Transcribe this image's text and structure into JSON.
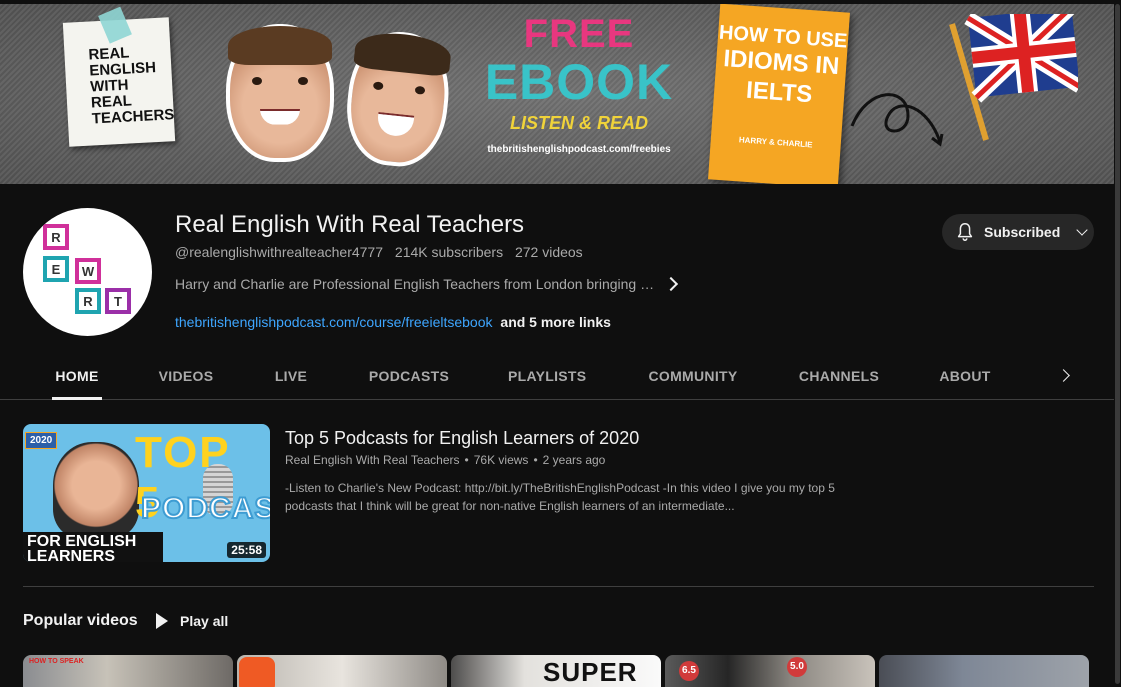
{
  "banner": {
    "note_text": "REAL ENGLISH WITH REAL TEACHERS",
    "promo_line1": "FREE",
    "promo_line2": "EBOOK",
    "promo_line3": "LISTEN & READ",
    "promo_url": "thebritishenglishpodcast.com/freebies",
    "book_line1": "HOW TO USE",
    "book_line2": "IDIOMS IN IELTS",
    "book_author": "HARRY & CHARLIE"
  },
  "channel": {
    "name": "Real English With Real Teachers",
    "handle": "@realenglishwithrealteacher4777",
    "subscribers": "214K subscribers",
    "videos": "272 videos",
    "description": "Harry and Charlie are Professional English Teachers from London bringing …",
    "link": "thebritishenglishpodcast.com/course/freeieltsebook",
    "more_links": "and 5 more links",
    "avatar_letters": [
      "R",
      "E",
      "W",
      "R",
      "T"
    ]
  },
  "subscribe_button": {
    "label": "Subscribed"
  },
  "tabs": [
    {
      "label": "HOME",
      "active": true
    },
    {
      "label": "VIDEOS"
    },
    {
      "label": "LIVE"
    },
    {
      "label": "PODCASTS"
    },
    {
      "label": "PLAYLISTS"
    },
    {
      "label": "COMMUNITY"
    },
    {
      "label": "CHANNELS"
    },
    {
      "label": "ABOUT"
    }
  ],
  "featured": {
    "title": "Top 5 Podcasts for English Learners of 2020",
    "channel": "Real English With Real Teachers",
    "views": "76K views",
    "age": "2 years ago",
    "description": "-Listen to Charlie's New Podcast: http://bit.ly/TheBritishEnglishPodcast -In this video I give you my top 5 podcasts that I think will be great for non-native English learners of an intermediate...",
    "duration": "25:58",
    "thumb_year": "2020",
    "thumb_top": "TOP 5",
    "thumb_podcasts": "PODCASTS",
    "thumb_bar": "FOR ENGLISH LEARNERS"
  },
  "popular": {
    "title": "Popular videos",
    "play_all": "Play all",
    "thumbs": [
      {
        "text": "HOW TO SPEAK"
      },
      {
        "text": ""
      },
      {
        "text": "SUPER"
      },
      {
        "badge1": "6.5",
        "badge2": "5.0"
      },
      {
        "text": ""
      }
    ]
  },
  "colors": {
    "link": "#3ea6ff",
    "background": "#0f0f0f",
    "accent_pink": "#e8377f",
    "accent_teal": "#39c3c8"
  }
}
